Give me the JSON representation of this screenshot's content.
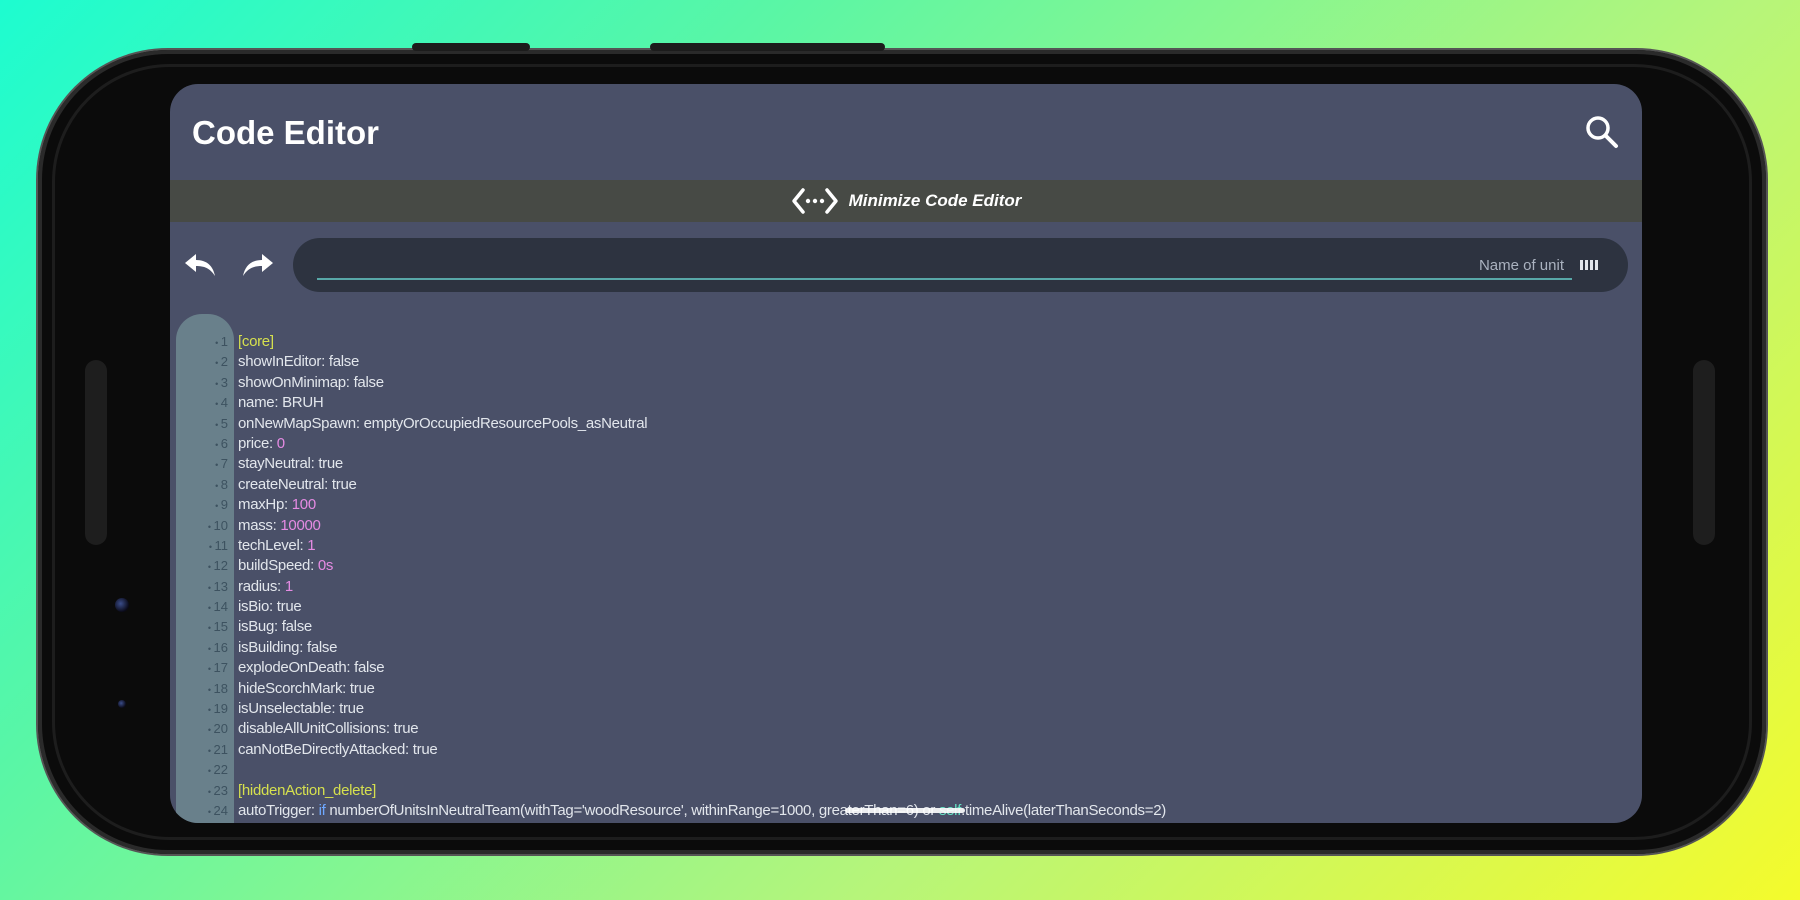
{
  "app": {
    "title": "Code Editor"
  },
  "minimize": {
    "label": "Minimize Code Editor"
  },
  "name_field": {
    "placeholder": "Name of unit"
  },
  "code_lines": [
    {
      "n": "1",
      "kind": "section",
      "text": "[core]"
    },
    {
      "n": "2",
      "kind": "kv",
      "key": "showInEditor:",
      "value": "false"
    },
    {
      "n": "3",
      "kind": "kv",
      "key": "showOnMinimap:",
      "value": "false"
    },
    {
      "n": "4",
      "kind": "kv",
      "key": "name:",
      "value": "BRUH"
    },
    {
      "n": "5",
      "kind": "kv",
      "key": "onNewMapSpawn:",
      "value": "emptyOrOccupiedResourcePools_asNeutral"
    },
    {
      "n": "6",
      "kind": "kv",
      "key": "price:",
      "value": "0",
      "value_class": "num"
    },
    {
      "n": "7",
      "kind": "kv",
      "key": "stayNeutral:",
      "value": "true"
    },
    {
      "n": "8",
      "kind": "kv",
      "key": "createNeutral:",
      "value": "true"
    },
    {
      "n": "9",
      "kind": "kv",
      "key": "maxHp:",
      "value": "100",
      "value_class": "num"
    },
    {
      "n": "10",
      "kind": "kv",
      "key": "mass:",
      "value": "10000",
      "value_class": "num"
    },
    {
      "n": "11",
      "kind": "kv",
      "key": "techLevel:",
      "value": "1",
      "value_class": "num"
    },
    {
      "n": "12",
      "kind": "kv",
      "key": "buildSpeed:",
      "value": "0s",
      "value_class": "num"
    },
    {
      "n": "13",
      "kind": "kv",
      "key": "radius:",
      "value": "1",
      "value_class": "num"
    },
    {
      "n": "14",
      "kind": "kv",
      "key": "isBio:",
      "value": "true"
    },
    {
      "n": "15",
      "kind": "kv",
      "key": "isBug:",
      "value": "false"
    },
    {
      "n": "16",
      "kind": "kv",
      "key": "isBuilding:",
      "value": "false"
    },
    {
      "n": "17",
      "kind": "kv",
      "key": "explodeOnDeath:",
      "value": "false"
    },
    {
      "n": "18",
      "kind": "kv",
      "key": "hideScorchMark:",
      "value": "true"
    },
    {
      "n": "19",
      "kind": "kv",
      "key": "isUnselectable:",
      "value": "true"
    },
    {
      "n": "20",
      "kind": "kv",
      "key": "disableAllUnitCollisions:",
      "value": "true"
    },
    {
      "n": "21",
      "kind": "kv",
      "key": "canNotBeDirectlyAttacked:",
      "value": "true"
    },
    {
      "n": "22",
      "kind": "blank",
      "text": ""
    },
    {
      "n": "23",
      "kind": "section",
      "text": "[hiddenAction_delete]"
    },
    {
      "n": "24",
      "kind": "autotrigger",
      "key": "autoTrigger:",
      "marker": "if",
      "expr": "numberOfUnitsInNeutralTeam(withTag='woodResource', withinRange=1000, greaterThan=6) or",
      "self_kw": "self",
      "tail": ".timeAlive(laterThanSeconds=2)"
    }
  ]
}
